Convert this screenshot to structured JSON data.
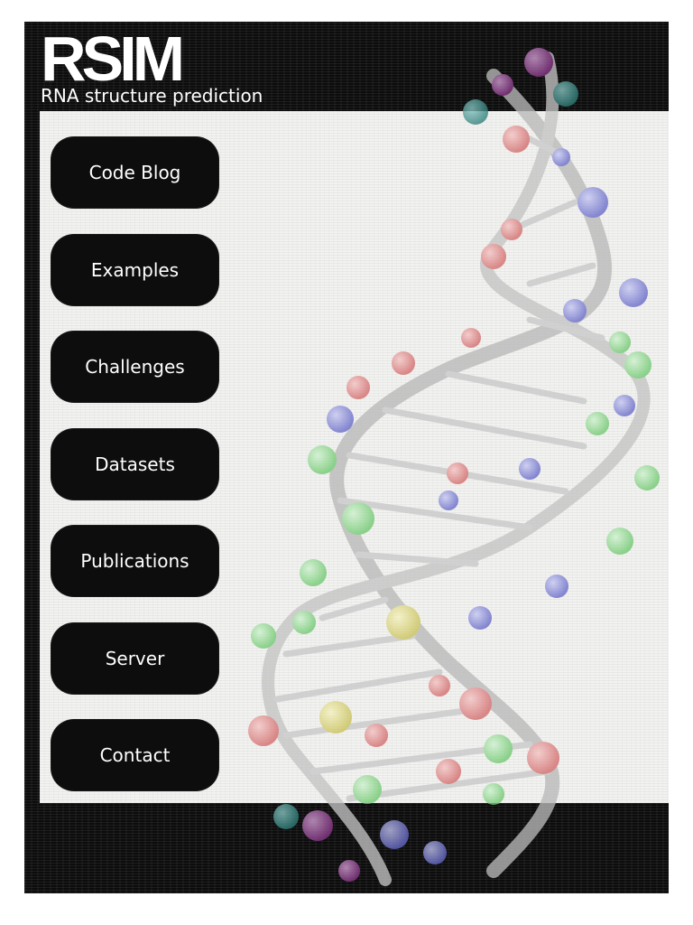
{
  "site": {
    "logo": "RSIM",
    "tagline": "RNA structure prediction"
  },
  "nav": {
    "items": [
      {
        "label": "Code Blog"
      },
      {
        "label": "Examples"
      },
      {
        "label": "Challenges"
      },
      {
        "label": "Datasets"
      },
      {
        "label": "Publications"
      },
      {
        "label": "Server"
      },
      {
        "label": "Contact"
      }
    ]
  },
  "theme": {
    "background": "#0c0c0c",
    "panel": "#f2f2f0",
    "button": "#0d0d0d",
    "text_light": "#ffffff"
  }
}
